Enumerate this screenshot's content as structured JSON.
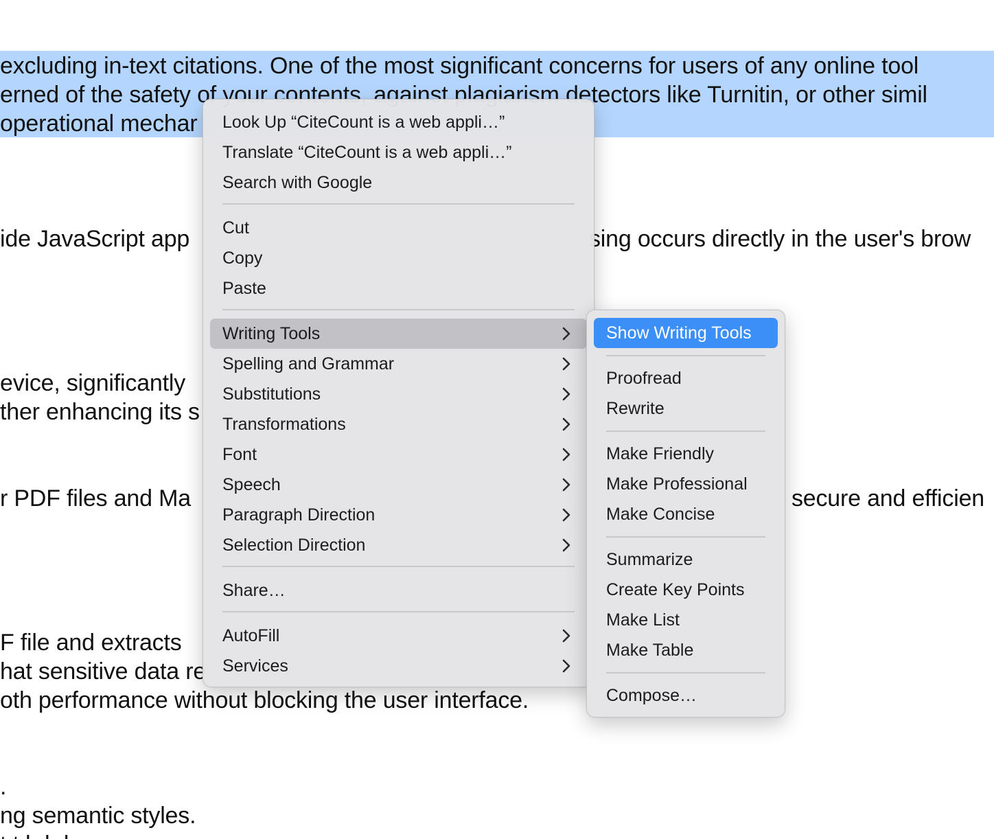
{
  "document": {
    "lines": [
      "excluding in-text citations. One of the most significant concerns for users of any online tool",
      "erned of the safety of your contents, against plagiarism detectors like Turnitin, or other simil",
      "operational mechar",
      "ide JavaScript app",
      "sing occurs directly in the user's brow",
      "evice, significantly",
      "ther enhancing its s",
      "r PDF files and Ma",
      "secure and efficien",
      "F file and extracts",
      "hat sensitive data re",
      "oth performance without blocking the user interface.",
      ".",
      "ng semantic styles.",
      "t           t  h  h  l"
    ]
  },
  "context_menu": {
    "group1": [
      "Look Up “CiteCount is a web appli…”",
      "Translate “CiteCount is a web appli…”",
      "Search with Google"
    ],
    "group2": [
      "Cut",
      "Copy",
      "Paste"
    ],
    "group3": [
      "Writing Tools",
      "Spelling and Grammar",
      "Substitutions",
      "Transformations",
      "Font",
      "Speech",
      "Paragraph Direction",
      "Selection Direction"
    ],
    "group4": [
      "Share…"
    ],
    "group5": [
      "AutoFill",
      "Services"
    ]
  },
  "writing_tools_submenu": {
    "primary": "Show Writing Tools",
    "group1": [
      "Proofread",
      "Rewrite"
    ],
    "group2": [
      "Make Friendly",
      "Make Professional",
      "Make Concise"
    ],
    "group3": [
      "Summarize",
      "Create Key Points",
      "Make List",
      "Make Table"
    ],
    "group4": [
      "Compose…"
    ]
  },
  "icons": {
    "submenu_indicator": "chevron-right-icon"
  },
  "colors": {
    "selection_highlight": "#b4d6fe",
    "menu_background": "#e4e4e6",
    "hover_item": "#c2c2c6",
    "accent_selected": "#3b8ff6"
  }
}
